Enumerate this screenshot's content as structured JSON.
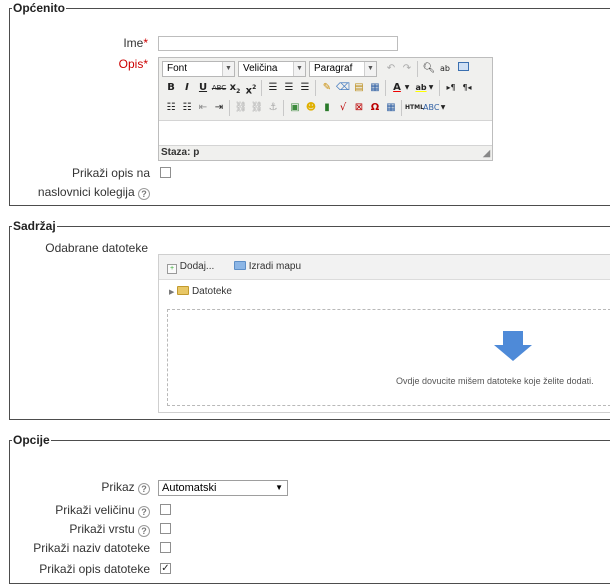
{
  "general": {
    "legend": "Općenito",
    "name_label": "Ime",
    "name_value": "",
    "description_label": "Opis",
    "required_mark": "*",
    "editor": {
      "font_select": "Font",
      "size_select": "Veličina",
      "paragraph_select": "Paragraf",
      "path_label": "Staza: p",
      "content": ""
    },
    "show_description_label_line1": "Prikaži opis na",
    "show_description_label_line2": "naslovnici kolegija",
    "show_description_checked": false
  },
  "content": {
    "legend": "Sadržaj",
    "files_label": "Odabrane datoteke",
    "add_label": "Dodaj...",
    "create_folder_label": "Izradi mapu",
    "folder_name": "Datoteke",
    "drop_text": "Ovdje dovucite mišem datoteke koje želite dodati."
  },
  "options": {
    "legend": "Opcije",
    "display_label": "Prikaz",
    "display_value": "Automatski",
    "show_size_label": "Prikaži veličinu",
    "show_size_checked": false,
    "show_type_label": "Prikaži vrstu",
    "show_type_checked": false,
    "show_filename_label": "Prikaži naziv datoteke",
    "show_filename_checked": false,
    "show_file_description_label": "Prikaži opis datoteke",
    "show_file_description_checked": true
  },
  "icons": {
    "help": "?",
    "check": "✓"
  }
}
